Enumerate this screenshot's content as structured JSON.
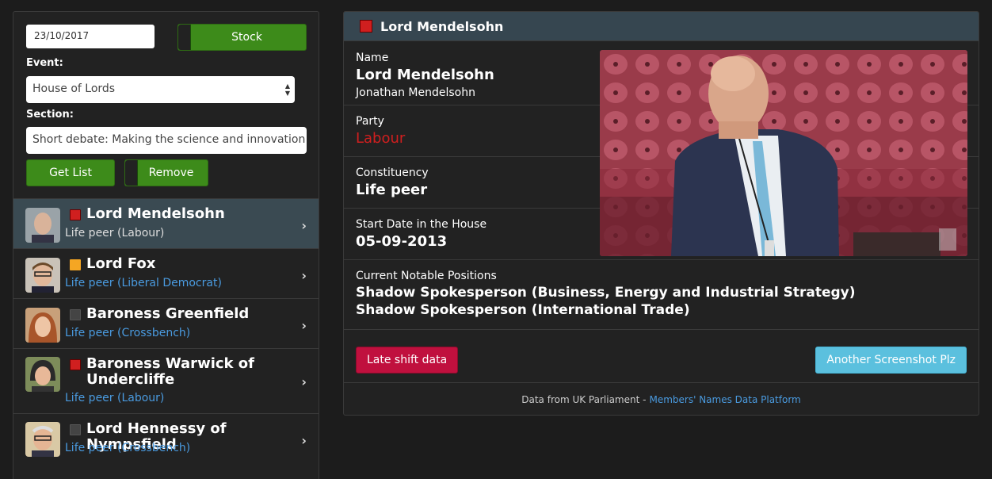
{
  "controls": {
    "date_value": "23/10/2017",
    "stock_label": "Stock",
    "event_label": "Event:",
    "event_value": "House of Lords",
    "section_label": "Section:",
    "section_value": "Short debate: Making the science and innovation st",
    "get_list_label": "Get List",
    "remove_label": "Remove"
  },
  "members": [
    {
      "name": "Lord Mendelsohn",
      "sub": "Life peer (Labour)",
      "party_color": "#d01f1f",
      "active": true
    },
    {
      "name": "Lord Fox",
      "sub": "Life peer (Liberal Democrat)",
      "party_color": "#f5a623",
      "active": false
    },
    {
      "name": "Baroness Greenfield",
      "sub": "Life peer (Crossbench)",
      "party_color": "#444444",
      "active": false
    },
    {
      "name": "Baroness Warwick of Undercliffe",
      "sub": "Life peer (Labour)",
      "party_color": "#d01f1f",
      "active": false
    },
    {
      "name": "Lord Hennessy of Nympsfield",
      "sub": "Life peer (Crossbench)",
      "party_color": "#444444",
      "active": false
    }
  ],
  "detail": {
    "header_title": "Lord Mendelsohn",
    "name_label": "Name",
    "name_value": "Lord Mendelsohn",
    "full_name": "Jonathan Mendelsohn",
    "party_label": "Party",
    "party_value": "Labour",
    "constituency_label": "Constituency",
    "constituency_value": "Life peer",
    "start_label": "Start Date in the House",
    "start_value": "05-09-2013",
    "positions_label": "Current Notable Positions",
    "positions": [
      "Shadow Spokesperson (Business, Energy and Industrial Strategy)",
      "Shadow Spokesperson (International Trade)"
    ],
    "late_shift_label": "Late shift data",
    "screenshot_label": "Another Screenshot Plz",
    "footer_text": "Data from UK Parliament -",
    "footer_link": "Members' Names Data Platform"
  },
  "colors": {
    "accent_green": "#3d8b1a",
    "labour_red": "#d01f1f",
    "link_blue": "#4a9be0",
    "info_button": "#5bc0de",
    "danger_button": "#c0103e"
  }
}
